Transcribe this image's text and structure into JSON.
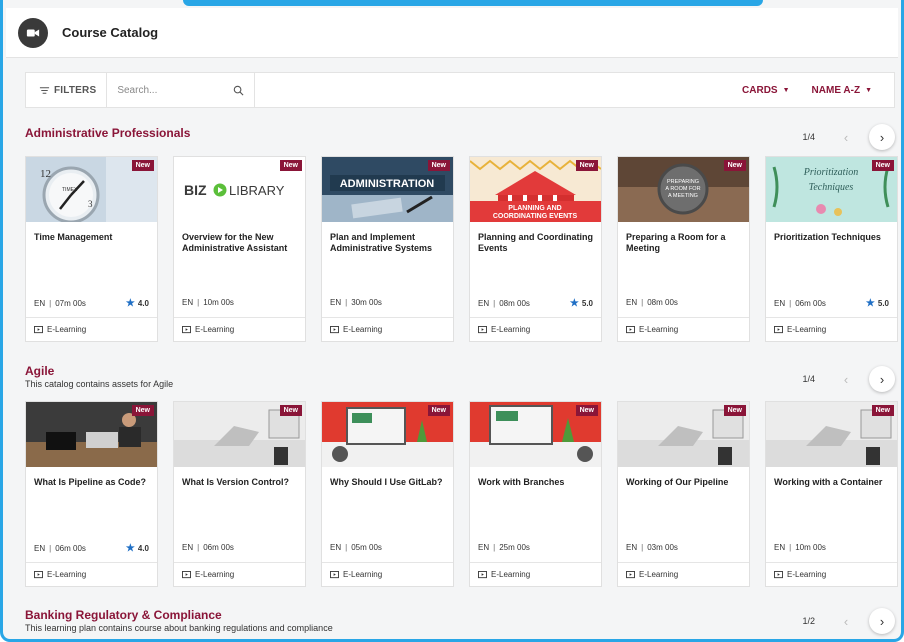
{
  "header": {
    "title": "Course Catalog",
    "logo_icon": "video-camera-icon"
  },
  "toolbar": {
    "filters_label": "FILTERS",
    "search_placeholder": "Search...",
    "view_label": "CARDS",
    "sort_label": "NAME A-Z"
  },
  "colors": {
    "accent": "#8a1538",
    "frame": "#29a6e6",
    "star": "#1f6fc5"
  },
  "sections": [
    {
      "title": "Administrative Professionals",
      "description": "",
      "page": "1/4",
      "cards": [
        {
          "title": "Time Management",
          "badge": "New",
          "lang": "EN",
          "duration": "07m 00s",
          "rating": "4.0",
          "type": "E-Learning"
        },
        {
          "title": "Overview for the New Administrative Assistant",
          "badge": "New",
          "lang": "EN",
          "duration": "10m 00s",
          "rating": "",
          "type": "E-Learning",
          "thumb_text": "BIZ LIBRARY"
        },
        {
          "title": "Plan and Implement Administrative Systems",
          "badge": "New",
          "lang": "EN",
          "duration": "30m 00s",
          "rating": "",
          "type": "E-Learning",
          "thumb_text": "ADMINISTRATION"
        },
        {
          "title": "Planning and Coordinating Events",
          "badge": "New",
          "lang": "EN",
          "duration": "08m 00s",
          "rating": "5.0",
          "type": "E-Learning",
          "thumb_text": "PLANNING AND COORDINATING EVENTS"
        },
        {
          "title": "Preparing a Room for a Meeting",
          "badge": "New",
          "lang": "EN",
          "duration": "08m 00s",
          "rating": "",
          "type": "E-Learning",
          "thumb_text": "PREPARING A ROOM FOR A MEETING"
        },
        {
          "title": "Prioritization Techniques",
          "badge": "New",
          "lang": "EN",
          "duration": "06m 00s",
          "rating": "5.0",
          "type": "E-Learning",
          "thumb_text": "Prioritization Techniques"
        }
      ]
    },
    {
      "title": "Agile",
      "description": "This catalog contains assets for Agile",
      "page": "1/4",
      "cards": [
        {
          "title": "What Is Pipeline as Code?",
          "badge": "New",
          "lang": "EN",
          "duration": "06m 00s",
          "rating": "4.0",
          "type": "E-Learning"
        },
        {
          "title": "What Is Version Control?",
          "badge": "New",
          "lang": "EN",
          "duration": "06m 00s",
          "rating": "",
          "type": "E-Learning"
        },
        {
          "title": "Why Should I Use GitLab?",
          "badge": "New",
          "lang": "EN",
          "duration": "05m 00s",
          "rating": "",
          "type": "E-Learning"
        },
        {
          "title": "Work with Branches",
          "badge": "New",
          "lang": "EN",
          "duration": "25m 00s",
          "rating": "",
          "type": "E-Learning"
        },
        {
          "title": "Working of Our Pipeline",
          "badge": "New",
          "lang": "EN",
          "duration": "03m 00s",
          "rating": "",
          "type": "E-Learning"
        },
        {
          "title": "Working with a Container",
          "badge": "New",
          "lang": "EN",
          "duration": "10m 00s",
          "rating": "",
          "type": "E-Learning"
        }
      ]
    },
    {
      "title": "Banking Regulatory & Compliance",
      "description": "This learning plan contains course about banking regulations and compliance",
      "page": "1/2",
      "cards": []
    }
  ]
}
